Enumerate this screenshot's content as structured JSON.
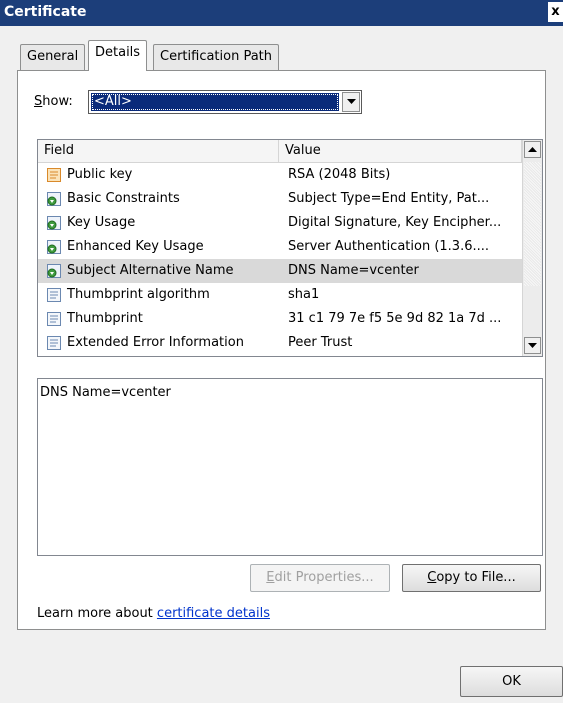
{
  "window": {
    "title": "Certificate",
    "close_glyph": "x"
  },
  "tabs": [
    {
      "label": "General"
    },
    {
      "label": "Details"
    },
    {
      "label": "Certification Path"
    }
  ],
  "show": {
    "label_underlined": "S",
    "label_rest": "how:",
    "selected": "<All>"
  },
  "table": {
    "columns": [
      "Field",
      "Value"
    ],
    "rows": [
      {
        "field": "Public key",
        "value": "RSA (2048 Bits)",
        "icon": "certificate-field-icon"
      },
      {
        "field": "Basic Constraints",
        "value": "Subject Type=End Entity, Pat...",
        "icon": "extension-icon"
      },
      {
        "field": "Key Usage",
        "value": "Digital Signature, Key Encipher...",
        "icon": "extension-icon"
      },
      {
        "field": "Enhanced Key Usage",
        "value": "Server Authentication (1.3.6....",
        "icon": "extension-icon"
      },
      {
        "field": "Subject Alternative Name",
        "value": "DNS Name=vcenter",
        "icon": "extension-icon",
        "selected": true
      },
      {
        "field": "Thumbprint algorithm",
        "value": "sha1",
        "icon": "property-icon"
      },
      {
        "field": "Thumbprint",
        "value": "31 c1 79 7e f5 5e 9d 82 1a 7d ...",
        "icon": "property-icon"
      },
      {
        "field": "Extended Error Information",
        "value": "Peer Trust",
        "icon": "property-icon"
      }
    ]
  },
  "detail": {
    "text": "DNS Name=vcenter"
  },
  "buttons": {
    "edit_properties_u": "E",
    "edit_properties_rest": "dit Properties...",
    "copy_to_file_u": "C",
    "copy_to_file_rest": "opy to File...",
    "ok": "OK"
  },
  "learn_more": {
    "prefix": "Learn more about ",
    "link": "certificate details"
  },
  "colors": {
    "titlebar": "#1c3e7a",
    "selection": "#0a2a7a",
    "link": "#0033cc"
  }
}
